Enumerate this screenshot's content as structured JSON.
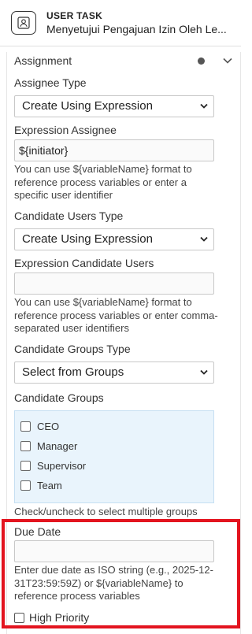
{
  "header": {
    "type_label": "USER TASK",
    "element_name": "Menyetujui Pengajuan Izin Oleh Le..."
  },
  "assignment": {
    "title": "Assignment"
  },
  "assignee_type": {
    "label": "Assignee Type",
    "value": "Create Using Expression"
  },
  "expression_assignee": {
    "label": "Expression Assignee",
    "value": "${initiator}",
    "help": "You can use ${variableName} format to reference process variables or enter a specific user identifier"
  },
  "candidate_users_type": {
    "label": "Candidate Users Type",
    "value": "Create Using Expression"
  },
  "expression_candidate_users": {
    "label": "Expression Candidate Users",
    "value": "",
    "help": "You can use ${variableName} format to reference process variables or enter comma-separated user identifiers"
  },
  "candidate_groups_type": {
    "label": "Candidate Groups Type",
    "value": "Select from Groups"
  },
  "candidate_groups": {
    "label": "Candidate Groups",
    "options": [
      "CEO",
      "Manager",
      "Supervisor",
      "Team"
    ],
    "help": "Check/uncheck to select multiple groups"
  },
  "due_date": {
    "label": "Due Date",
    "value": "",
    "help": "Enter due date as ISO string (e.g., 2025-12-31T23:59:59Z) or ${variableName} to reference process variables"
  },
  "high_priority": {
    "label": "High Priority",
    "checked": false
  },
  "colors": {
    "highlight": "#e3141f",
    "groups_bg": "#e9f4fc"
  }
}
